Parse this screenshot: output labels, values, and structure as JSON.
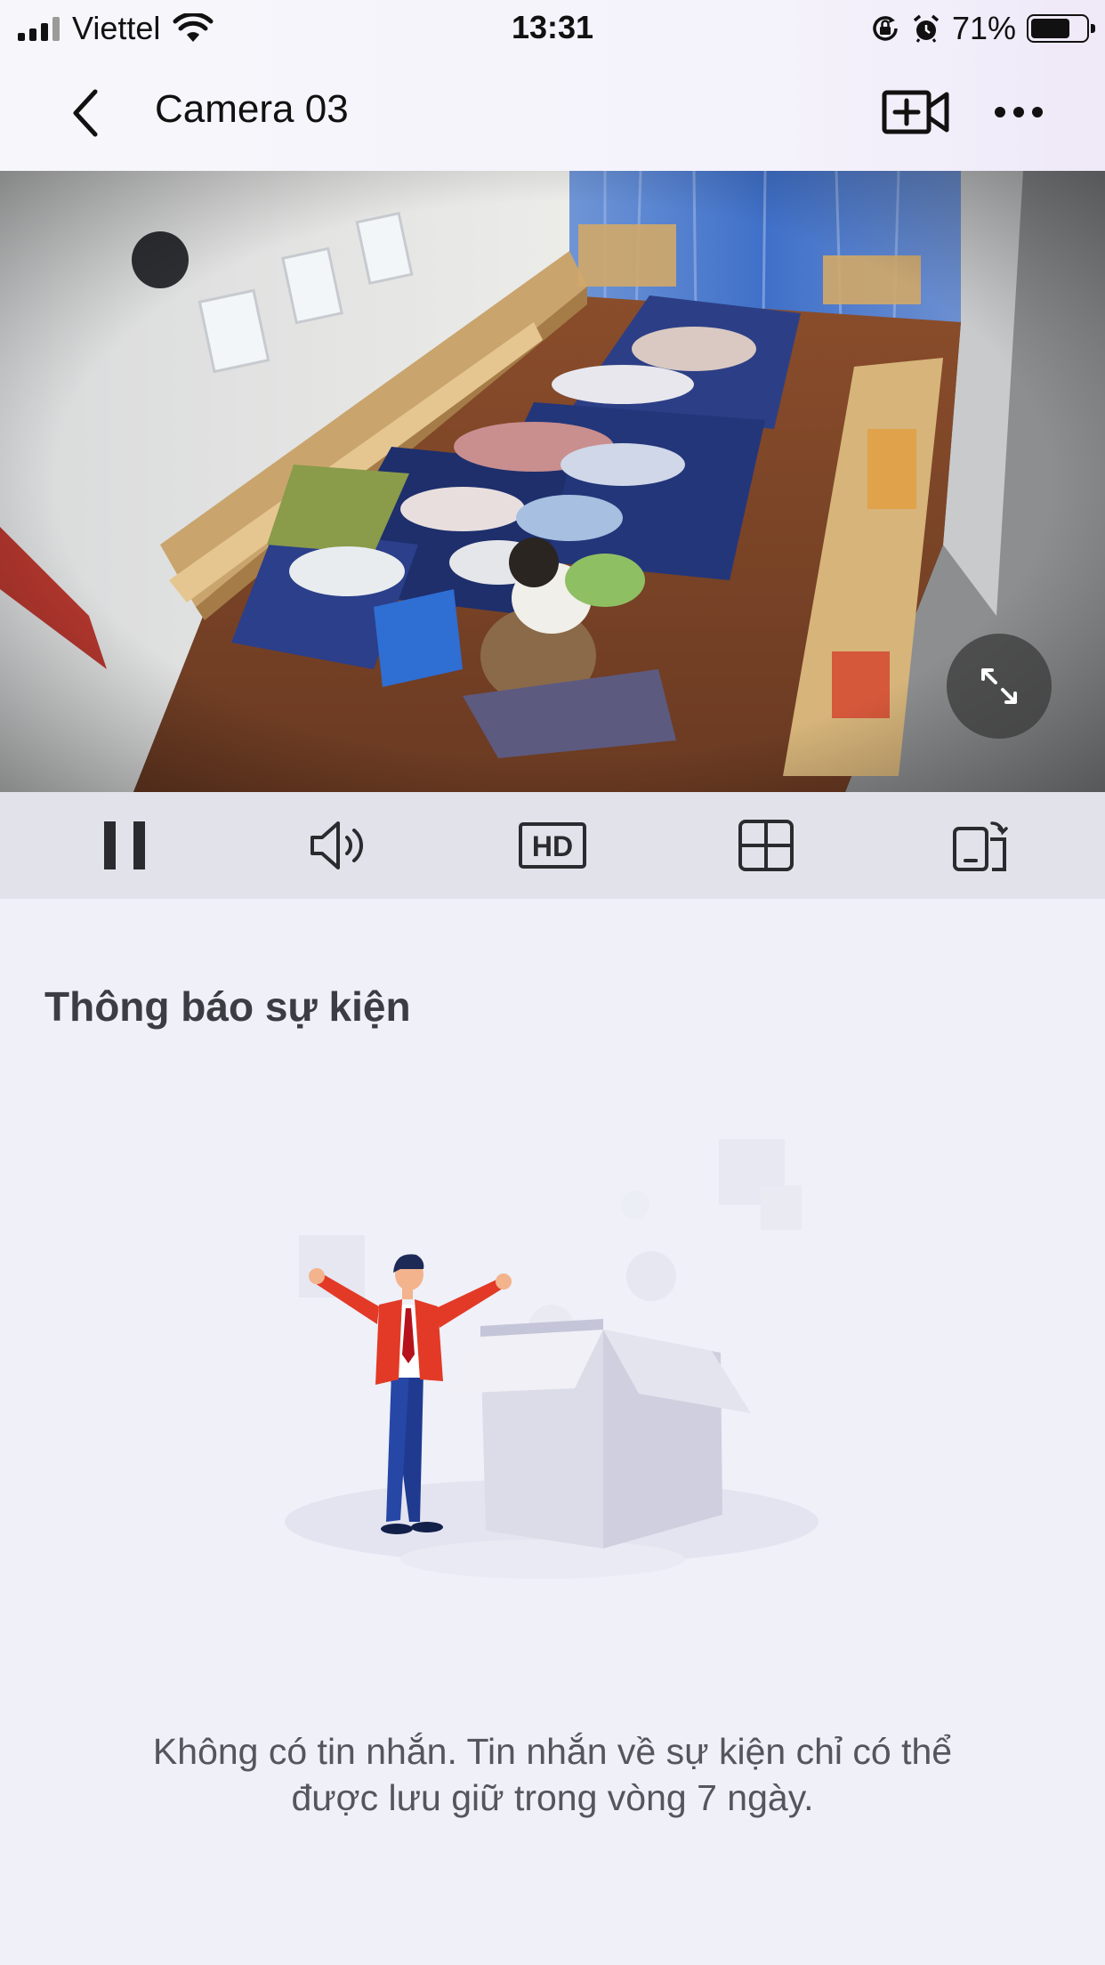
{
  "status_bar": {
    "carrier": "Viettel",
    "time": "13:31",
    "battery_percent": "71%",
    "battery_level": 0.71,
    "icons": [
      "signal-icon",
      "wifi-icon",
      "orientation-lock-icon",
      "alarm-icon",
      "battery-icon"
    ]
  },
  "nav": {
    "title": "Camera 03",
    "icons": [
      "back-chevron-icon",
      "add-video-icon",
      "more-dots-icon"
    ]
  },
  "video": {
    "icons": [
      "fullscreen-icon"
    ]
  },
  "controls": {
    "hd_label": "HD",
    "icons": [
      "pause-icon",
      "speaker-icon",
      "hd-quality-icon",
      "multi-view-grid-icon",
      "screen-rotate-icon"
    ]
  },
  "events": {
    "title": "Thông báo sự kiện",
    "empty_line1": "Không có tin nhắn. Tin nhắn về sự kiện chỉ có thể",
    "empty_line2": "được lưu giữ trong vòng 7 ngày."
  },
  "colors": {
    "page_background": "#eff0f8",
    "control_bar": "#e2e3ea",
    "illustration_jacket": "#e23a26",
    "illustration_trousers": "#1f3a8f"
  }
}
